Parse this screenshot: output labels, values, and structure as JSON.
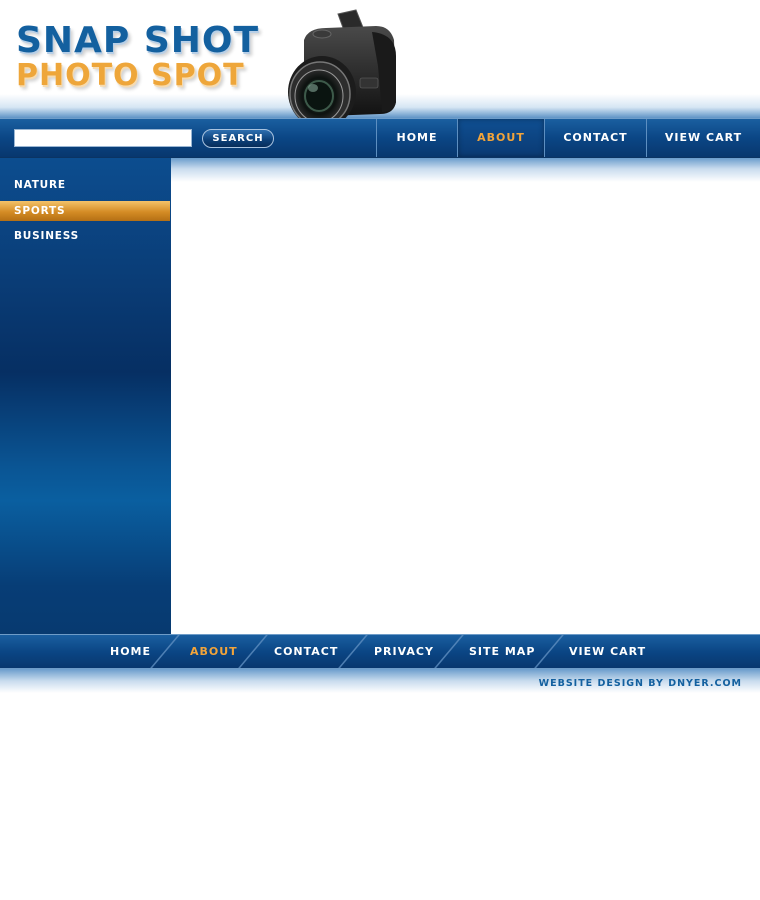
{
  "logo": {
    "line1": "SNAP SHOT",
    "line2": "PHOTO SPOT"
  },
  "search": {
    "value": "",
    "placeholder": "",
    "button_label": "SEARCH"
  },
  "top_nav": {
    "items": [
      {
        "label": "HOME",
        "active": false
      },
      {
        "label": "ABOUT",
        "active": true
      },
      {
        "label": "CONTACT",
        "active": false
      },
      {
        "label": "VIEW CART",
        "active": false
      }
    ]
  },
  "sidebar": {
    "items": [
      {
        "label": "NATURE",
        "active": false
      },
      {
        "label": "SPORTS",
        "active": true
      },
      {
        "label": "BUSINESS",
        "active": false
      }
    ]
  },
  "bottom_nav": {
    "items": [
      {
        "label": "HOME",
        "active": false
      },
      {
        "label": "ABOUT",
        "active": true
      },
      {
        "label": "CONTACT",
        "active": false
      },
      {
        "label": "PRIVACY",
        "active": false
      },
      {
        "label": "SITE MAP",
        "active": false
      },
      {
        "label": "VIEW CART",
        "active": false
      }
    ]
  },
  "footer": {
    "credit": "WEBSITE DESIGN BY DNYER.COM"
  },
  "colors": {
    "brand_blue": "#13609f",
    "accent_orange": "#f2a43a",
    "nav_dark_blue": "#0b4685"
  },
  "icons": {
    "camera": "camera-icon"
  }
}
